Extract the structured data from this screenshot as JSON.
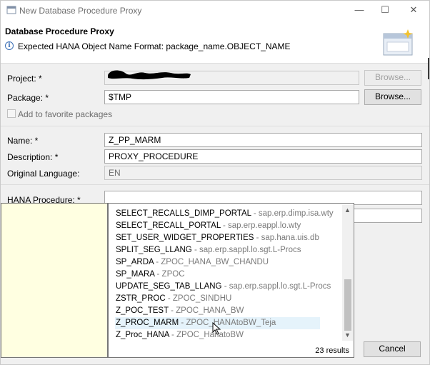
{
  "window": {
    "title": "New Database Procedure Proxy"
  },
  "header": {
    "title": "Database Procedure Proxy",
    "info": "Expected HANA Object Name Format: package_name.OBJECT_NAME"
  },
  "form": {
    "project_label": "Project: *",
    "project_value": "",
    "package_label": "Package: *",
    "package_value": "$TMP",
    "browse_label": "Browse...",
    "favorite_label": "Add to favorite packages",
    "name_label": "Name: *",
    "name_value": "Z_PP_MARM",
    "description_label": "Description: *",
    "description_value": "PROXY_PROCEDURE",
    "language_label": "Original Language:",
    "language_value": "EN",
    "hana_label": "HANA Procedure: *",
    "hana_value": ""
  },
  "popup": {
    "items": [
      {
        "name": "SELECT_RECALLS_DIMP_PORTAL",
        "pkg": " - sap.erp.dimp.isa.wty"
      },
      {
        "name": "SELECT_RECALL_PORTAL",
        "pkg": " - sap.erp.eappl.lo.wty"
      },
      {
        "name": "SET_USER_WIDGET_PROPERTIES",
        "pkg": " - sap.hana.uis.db"
      },
      {
        "name": "SPLIT_SEG_LLANG",
        "pkg": " - sap.erp.sappl.lo.sgt.L-Procs"
      },
      {
        "name": "SP_ARDA",
        "pkg": " - ZPOC_HANA_BW_CHANDU"
      },
      {
        "name": "SP_MARA",
        "pkg": " - ZPOC"
      },
      {
        "name": "UPDATE_SEG_TAB_LLANG",
        "pkg": " - sap.erp.sappl.lo.sgt.L-Procs"
      },
      {
        "name": "ZSTR_PROC",
        "pkg": " - ZPOC_SINDHU"
      },
      {
        "name": "Z_POC_TEST",
        "pkg": " - ZPOC_HANA_BW"
      },
      {
        "name": "Z_PROC_MARM",
        "pkg": " - ZPOC_HANAtoBW_Teja"
      },
      {
        "name": "Z_Proc_HANA",
        "pkg": " - ZPOC_HanatoBW"
      }
    ],
    "results": "23 results"
  },
  "footer": {
    "cancel_label": "Cancel"
  },
  "colors": {
    "selection": "#e5f3fb",
    "tooltip_bg": "#ffffe1",
    "info_blue": "#3b6fb6"
  }
}
